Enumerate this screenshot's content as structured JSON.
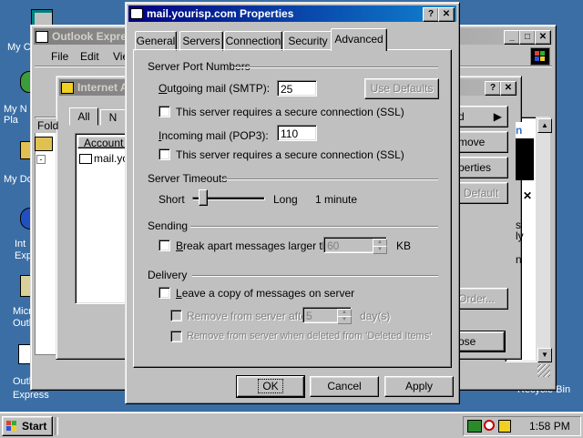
{
  "desktop": {
    "icons": [
      {
        "label": "My C"
      },
      {
        "label": "My N Pla"
      },
      {
        "label": "My Do"
      },
      {
        "label": "Int Exp"
      },
      {
        "label": "Micr Outl"
      },
      {
        "label": "Outlook Express"
      }
    ],
    "recycle_bin": "Recycle Bin"
  },
  "outlook_window": {
    "title": "Outlook Expre",
    "menu": [
      "File",
      "Edit",
      "Vie"
    ]
  },
  "accounts_window": {
    "title": "Internet Acc",
    "tabs": [
      "All",
      "N"
    ],
    "column_header": "Account",
    "account_item": "mail.yo",
    "folder_label": "Fold",
    "right_buttons": [
      "d",
      "move",
      "perties",
      "Default",
      "Order...",
      "ose"
    ],
    "partial_text": [
      "s",
      "ly",
      "n"
    ]
  },
  "dialog": {
    "title": "mail.yourisp.com Properties",
    "tabs": [
      "General",
      "Servers",
      "Connection",
      "Security",
      "Advanced"
    ],
    "active_tab": "Advanced",
    "server_ports": {
      "heading": "Server Port Numbers",
      "outgoing_label": "Outgoing mail (SMTP):",
      "outgoing_value": "25",
      "use_defaults": "Use Defaults",
      "ssl_outgoing": "This server requires a secure connection (SSL)",
      "incoming_label": "Incoming mail (POP3):",
      "incoming_value": "110",
      "ssl_incoming": "This server requires a secure connection (SSL)"
    },
    "timeouts": {
      "heading": "Server Timeouts",
      "short": "Short",
      "long": "Long",
      "value": "1 minute",
      "slider_level": 0.1
    },
    "sending": {
      "heading": "Sending",
      "break_apart": "Break apart messages larger than",
      "size_value": "60",
      "unit": "KB"
    },
    "delivery": {
      "heading": "Delivery",
      "leave_copy": "Leave a copy of messages on server",
      "remove_after": "Remove from server after",
      "days_value": "5",
      "days_unit": "day(s)",
      "remove_deleted": "Remove from server when deleted from 'Deleted Items'"
    },
    "buttons": {
      "ok": "OK",
      "cancel": "Cancel",
      "apply": "Apply"
    }
  },
  "taskbar": {
    "start": "Start",
    "clock": "1:58 PM"
  }
}
